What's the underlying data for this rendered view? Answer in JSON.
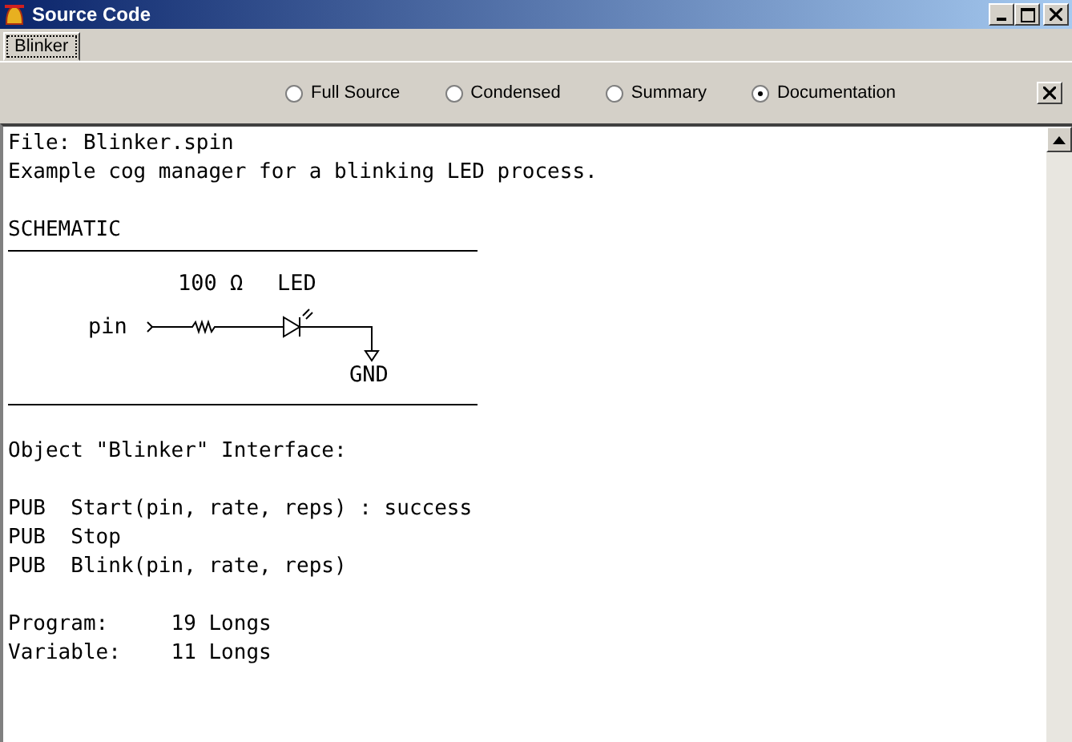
{
  "window": {
    "title": "Source Code"
  },
  "tabs": [
    {
      "label": "Blinker",
      "selected": true
    }
  ],
  "views": [
    {
      "label": "Full Source",
      "selected": false
    },
    {
      "label": "Condensed",
      "selected": false
    },
    {
      "label": "Summary",
      "selected": false
    },
    {
      "label": "Documentation",
      "selected": true
    }
  ],
  "document": [
    {
      "kind": "text",
      "text": "File: Blinker.spin"
    },
    {
      "kind": "text",
      "text": "Example cog manager for a blinking LED process."
    },
    {
      "kind": "blank"
    },
    {
      "kind": "text",
      "text": "SCHEMATIC"
    },
    {
      "kind": "rule"
    },
    {
      "kind": "schematic",
      "labels": {
        "resistor": "100 Ω",
        "led": "LED",
        "pin": "pin",
        "ground": "GND"
      }
    },
    {
      "kind": "rule"
    },
    {
      "kind": "blank"
    },
    {
      "kind": "text",
      "text": "Object \"Blinker\" Interface:"
    },
    {
      "kind": "blank"
    },
    {
      "kind": "text",
      "text": "PUB  Start(pin, rate, reps) : success"
    },
    {
      "kind": "text",
      "text": "PUB  Stop"
    },
    {
      "kind": "text",
      "text": "PUB  Blink(pin, rate, reps)"
    },
    {
      "kind": "blank"
    },
    {
      "kind": "text",
      "text": "Program:     19 Longs"
    },
    {
      "kind": "text",
      "text": "Variable:    11 Longs"
    }
  ]
}
